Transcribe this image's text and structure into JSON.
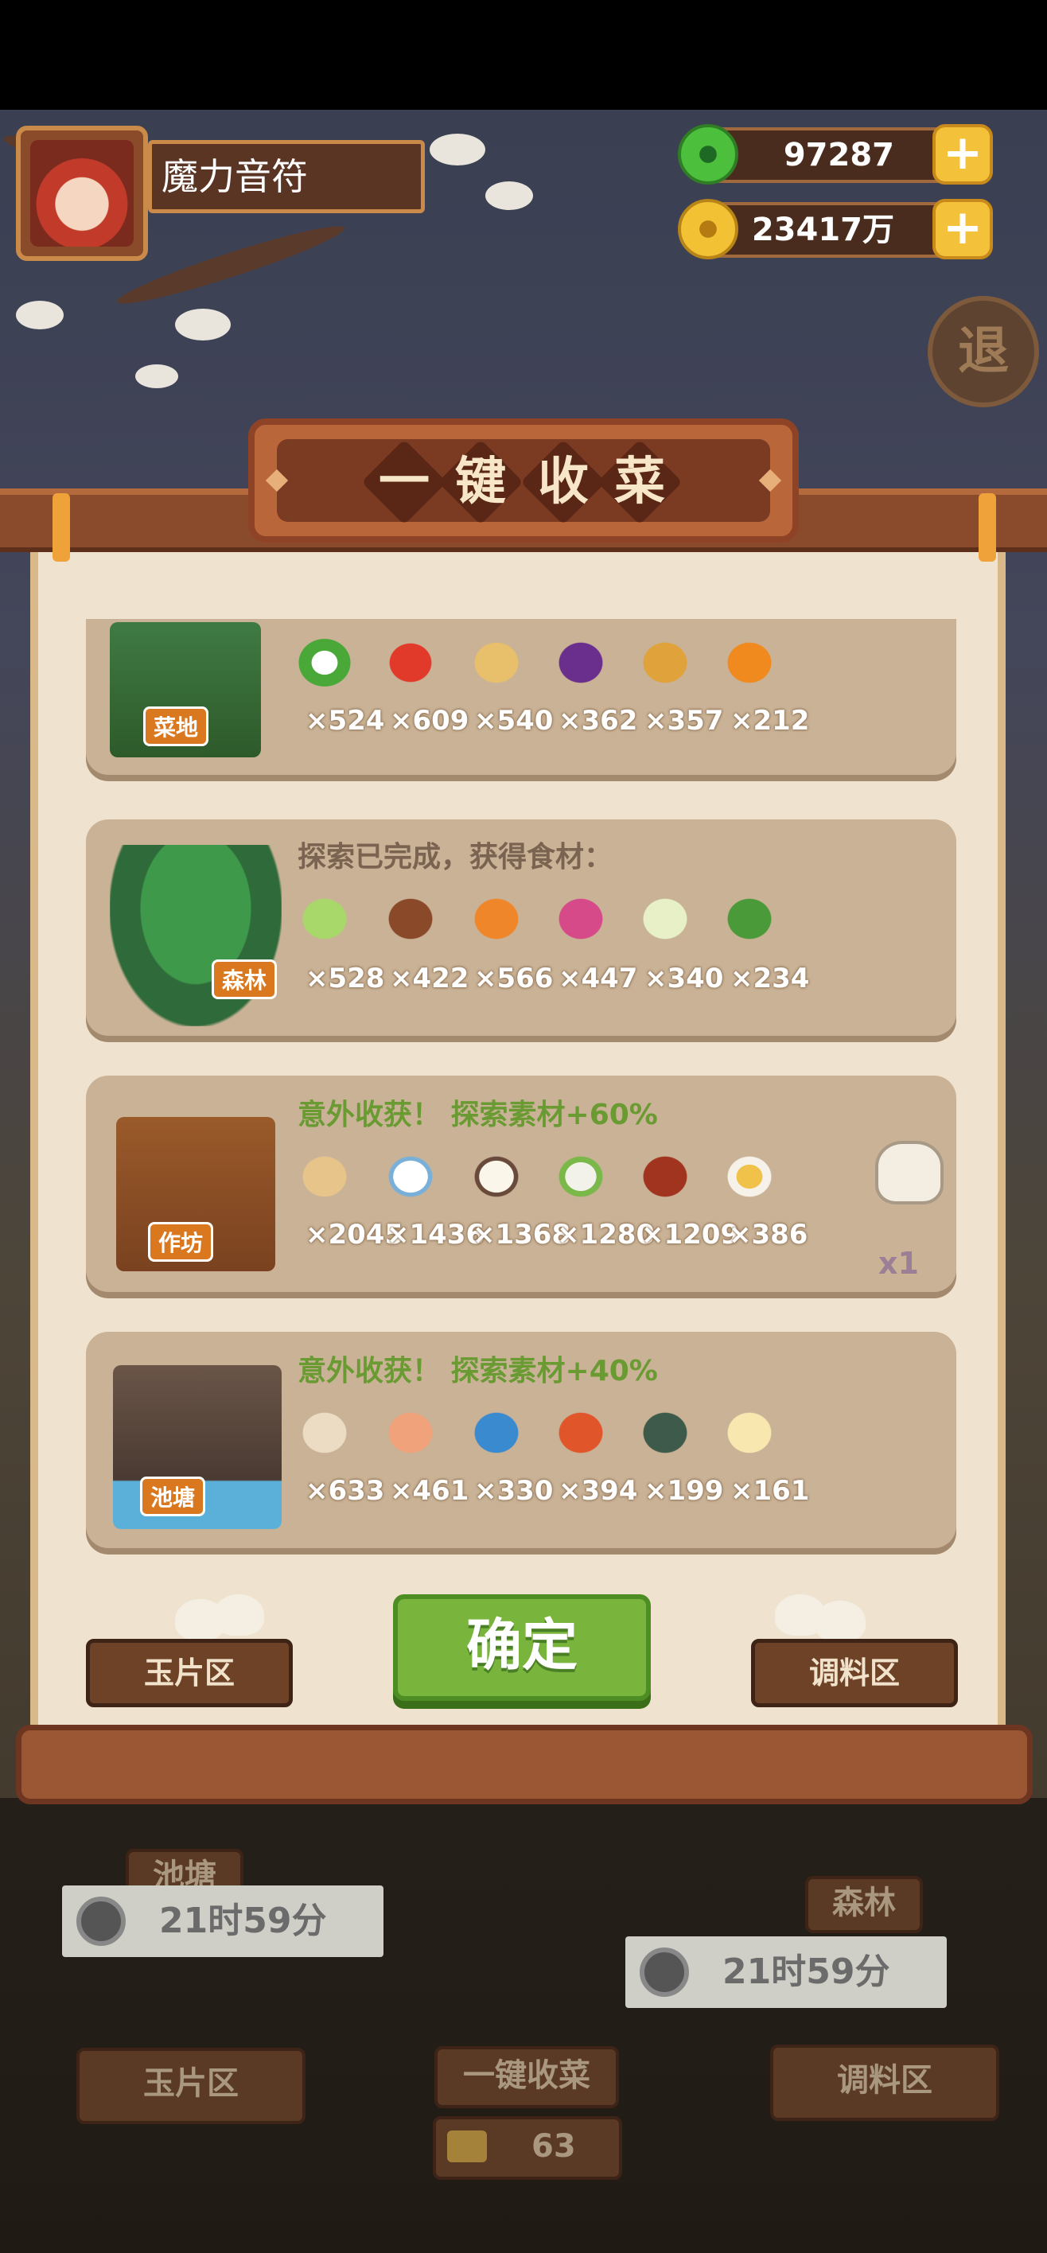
{
  "player": {
    "name": "魔力音符"
  },
  "resources": {
    "jade": {
      "value": "97287",
      "icon": "jade-coin-icon"
    },
    "gold": {
      "value": "23417万",
      "icon": "gold-coin-icon"
    },
    "plus_label": "+"
  },
  "exit_label": "退",
  "panel": {
    "title_chars": [
      "一",
      "键",
      "收",
      "菜"
    ]
  },
  "cards": [
    {
      "tag": "菜地",
      "note": "",
      "items": [
        {
          "icon": "green-onion-icon",
          "count": "×524"
        },
        {
          "icon": "chili-pepper-icon",
          "count": "×609"
        },
        {
          "icon": "potato-icon",
          "count": "×540"
        },
        {
          "icon": "eggplant-icon",
          "count": "×362"
        },
        {
          "icon": "pineapple-icon",
          "count": "×357"
        },
        {
          "icon": "pumpkin-icon",
          "count": "×212"
        }
      ]
    },
    {
      "tag": "森林",
      "note": "探索已完成，获得食材：",
      "items": [
        {
          "icon": "cabbage-icon",
          "count": "×528"
        },
        {
          "icon": "mushroom-icon",
          "count": "×422"
        },
        {
          "icon": "carrot-icon",
          "count": "×566"
        },
        {
          "icon": "radish-icon",
          "count": "×447"
        },
        {
          "icon": "bamboo-shoot-icon",
          "count": "×340"
        },
        {
          "icon": "herb-leaf-icon",
          "count": "×234"
        }
      ]
    },
    {
      "tag": "作坊",
      "note": "意外收获！ 探索素材+60%",
      "items": [
        {
          "icon": "flour-sack-icon",
          "count": "×2045"
        },
        {
          "icon": "rice-bowl-icon",
          "count": "×1436"
        },
        {
          "icon": "tofu-icon",
          "count": "×1368"
        },
        {
          "icon": "rice-dish-icon",
          "count": "×1280"
        },
        {
          "icon": "wine-jar-icon",
          "count": "×1209"
        },
        {
          "icon": "sauce-boat-icon",
          "count": "×386"
        }
      ],
      "extra": {
        "icon": "rice-ball-icon",
        "count": "x1"
      }
    },
    {
      "tag": "池塘",
      "note": "意外收获！ 探索素材+40%",
      "items": [
        {
          "icon": "clam-icon",
          "count": "×633"
        },
        {
          "icon": "shrimp-icon",
          "count": "×461"
        },
        {
          "icon": "fish-icon",
          "count": "×330"
        },
        {
          "icon": "meat-icon",
          "count": "×394"
        },
        {
          "icon": "crab-icon",
          "count": "×199"
        },
        {
          "icon": "fin-icon",
          "count": "×161"
        }
      ]
    }
  ],
  "confirm_label": "确定",
  "nav": {
    "left": "玉片区",
    "right": "调料区"
  },
  "background": {
    "timer_left": "21时59分",
    "timer_right": "21时59分",
    "tag_pond": "池塘",
    "tag_forest": "森林",
    "left_sign": "玉片区",
    "right_sign": "调料区",
    "harvest_sign": "一键收菜",
    "counter": "63"
  },
  "colors": {
    "note_plain": "#7a6350",
    "note_bonus": "#6a9a32",
    "confirm_green": "#79b43c",
    "tag_orange": "#d9781f"
  }
}
